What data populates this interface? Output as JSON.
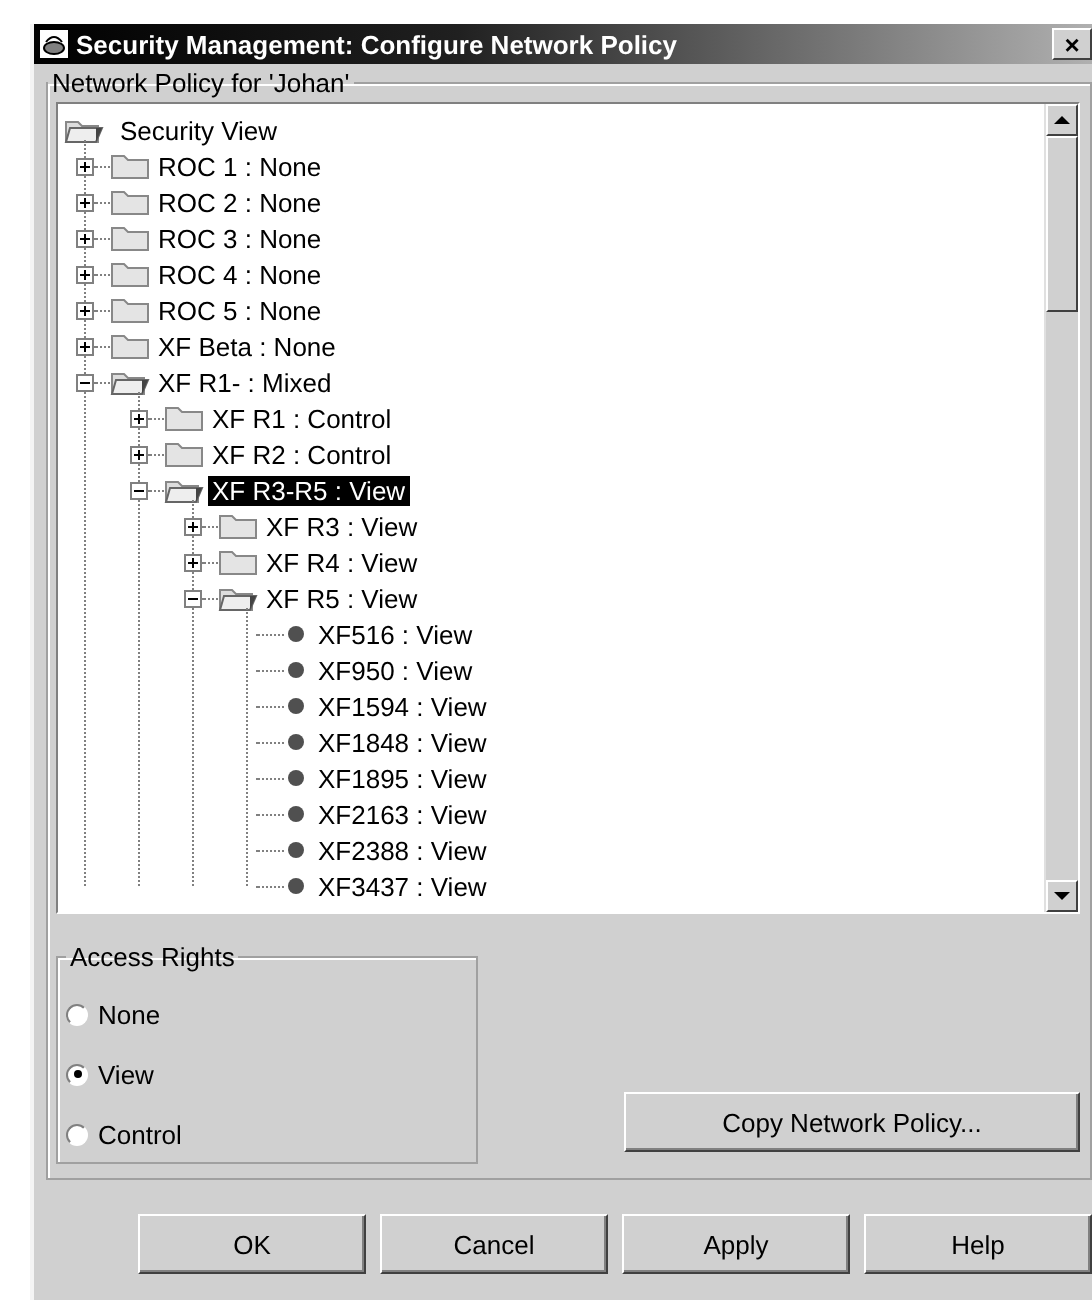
{
  "window": {
    "title": "Security Management: Configure Network Policy",
    "close": "×"
  },
  "policy_group": {
    "title": "Network Policy for 'Johan'"
  },
  "tree": [
    {
      "label": "Security View",
      "kind": "root",
      "expanded": true,
      "selected": false,
      "children": [
        {
          "label": "ROC 1 : None",
          "kind": "folder",
          "expanded": false,
          "selected": false
        },
        {
          "label": "ROC 2 : None",
          "kind": "folder",
          "expanded": false,
          "selected": false
        },
        {
          "label": "ROC 3 : None",
          "kind": "folder",
          "expanded": false,
          "selected": false
        },
        {
          "label": "ROC 4 : None",
          "kind": "folder",
          "expanded": false,
          "selected": false
        },
        {
          "label": "ROC 5 : None",
          "kind": "folder",
          "expanded": false,
          "selected": false
        },
        {
          "label": "XF Beta : None",
          "kind": "folder",
          "expanded": false,
          "selected": false
        },
        {
          "label": "XF R1- : Mixed",
          "kind": "folder",
          "expanded": true,
          "selected": false,
          "children": [
            {
              "label": "XF R1 : Control",
              "kind": "folder",
              "expanded": false,
              "selected": false
            },
            {
              "label": "XF R2 : Control",
              "kind": "folder",
              "expanded": false,
              "selected": false
            },
            {
              "label": "XF R3-R5 : View",
              "kind": "folder",
              "expanded": true,
              "selected": true,
              "children": [
                {
                  "label": "XF R3 : View",
                  "kind": "folder",
                  "expanded": false,
                  "selected": false
                },
                {
                  "label": "XF R4 : View",
                  "kind": "folder",
                  "expanded": false,
                  "selected": false
                },
                {
                  "label": "XF R5 : View",
                  "kind": "folder",
                  "expanded": true,
                  "selected": false,
                  "children": [
                    {
                      "label": "XF516 : View",
                      "kind": "leaf",
                      "selected": false
                    },
                    {
                      "label": "XF950 : View",
                      "kind": "leaf",
                      "selected": false
                    },
                    {
                      "label": "XF1594 : View",
                      "kind": "leaf",
                      "selected": false
                    },
                    {
                      "label": "XF1848 : View",
                      "kind": "leaf",
                      "selected": false
                    },
                    {
                      "label": "XF1895 : View",
                      "kind": "leaf",
                      "selected": false
                    },
                    {
                      "label": "XF2163 : View",
                      "kind": "leaf",
                      "selected": false
                    },
                    {
                      "label": "XF2388 : View",
                      "kind": "leaf",
                      "selected": false
                    },
                    {
                      "label": "XF3437 : View",
                      "kind": "leaf",
                      "selected": false
                    }
                  ]
                }
              ]
            }
          ]
        }
      ]
    }
  ],
  "access_rights": {
    "title": "Access Rights",
    "options": [
      {
        "label": "None",
        "selected": false
      },
      {
        "label": "View",
        "selected": true
      },
      {
        "label": "Control",
        "selected": false
      }
    ]
  },
  "copy_button": "Copy Network Policy...",
  "buttons": [
    "OK",
    "Cancel",
    "Apply",
    "Help"
  ]
}
